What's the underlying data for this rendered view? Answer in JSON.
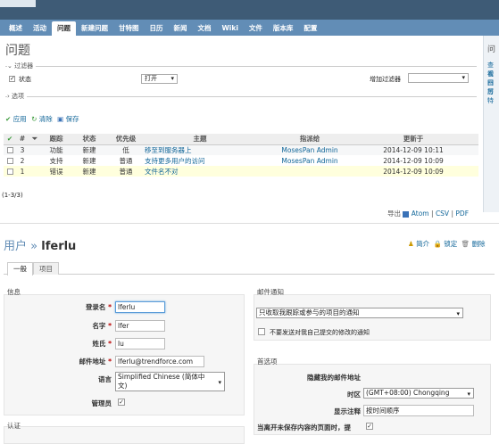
{
  "nav": {
    "tabs": [
      {
        "label": "概述"
      },
      {
        "label": "活动"
      },
      {
        "label": "问题"
      },
      {
        "label": "新建问题"
      },
      {
        "label": "甘特图"
      },
      {
        "label": "日历"
      },
      {
        "label": "新闻"
      },
      {
        "label": "文档"
      },
      {
        "label": "Wiki"
      },
      {
        "label": "文件"
      },
      {
        "label": "版本库"
      },
      {
        "label": "配置"
      }
    ],
    "active_index": 2
  },
  "issues": {
    "title": "问题",
    "filters_legend": "过滤器",
    "status_label": "状态",
    "status_value": "打开",
    "add_filter_label": "增加过滤器",
    "options_legend": "选项",
    "actions": {
      "apply": "应用",
      "clear": "清除",
      "save": "保存"
    },
    "columns": [
      "#",
      "跟踪",
      "状态",
      "优先级",
      "主题",
      "指派给",
      "更新于"
    ],
    "rows": [
      {
        "id": "3",
        "tracker": "功能",
        "status": "新建",
        "priority": "低",
        "subject": "移至到服务器上",
        "assignee": "MosesPan Admin",
        "updated": "2014-12-09 10:11"
      },
      {
        "id": "2",
        "tracker": "支持",
        "status": "新建",
        "priority": "普通",
        "subject": "支持更多用户的访问",
        "assignee": "MosesPan Admin",
        "updated": "2014-12-09 10:09"
      },
      {
        "id": "1",
        "tracker": "错误",
        "status": "新建",
        "priority": "普通",
        "subject": "文件名不对",
        "assignee": "",
        "updated": "2014-12-09 10:09"
      }
    ],
    "pagination": "(1-3/3)",
    "export": {
      "label": "导出",
      "atom": "Atom",
      "csv": "CSV",
      "pdf": "PDF",
      "separator": "|"
    }
  },
  "sidebar": {
    "title": "问",
    "links": [
      "查看",
      "视图",
      "日历",
      "甘特"
    ]
  },
  "user": {
    "breadcrumb_parent": "用户",
    "separator": "»",
    "name": "lferlu",
    "actions": {
      "summary": "简介",
      "lock": "锁定",
      "delete": "删除"
    },
    "tabs": [
      "一般",
      "项目"
    ],
    "info": {
      "legend": "信息",
      "login_label": "登录名",
      "login_value": "lferlu",
      "firstname_label": "名字",
      "firstname_value": "lfer",
      "lastname_label": "姓氏",
      "lastname_value": "lu",
      "email_label": "邮件地址",
      "email_value": "lferlu@trendforce.com",
      "language_label": "语言",
      "language_value_line1": "Simplified Chinese (简体中",
      "language_value_line2": "文)",
      "admin_label": "管理员",
      "required_mark": "*"
    },
    "auth": {
      "legend": "认证"
    },
    "mail": {
      "legend": "邮件通知",
      "option_value": "只收取我跟踪或参与的项目的通知",
      "no_self_label": "不要发送对我自己提交的修改的通知"
    },
    "prefs": {
      "legend": "首选项",
      "hide_mail_label": "隐藏我的邮件地址",
      "timezone_label": "时区",
      "timezone_value": "(GMT+08:00) Chongqing",
      "comments_label": "显示注释",
      "comments_value": "按时间顺序",
      "warn_label": "当离开未保存内容的页面时，提"
    }
  }
}
